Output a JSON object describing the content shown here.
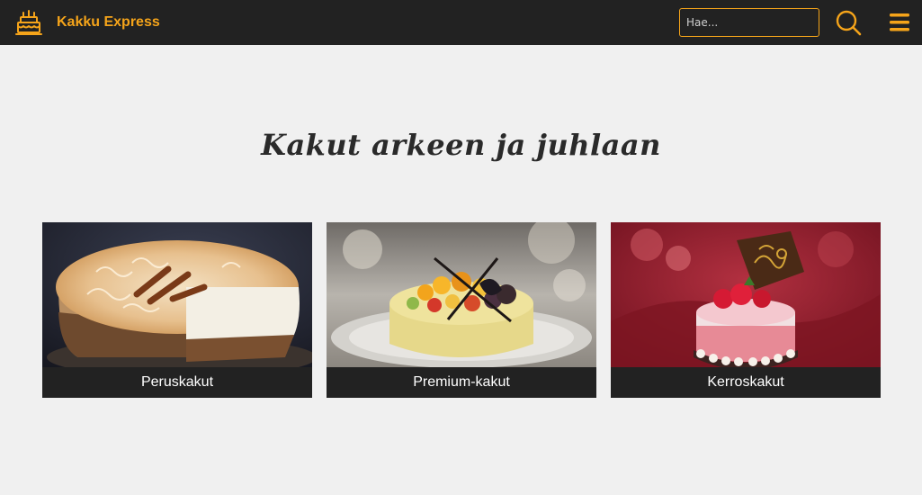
{
  "header": {
    "brand_name": "Kakku Express",
    "brand_icon": "cake-icon",
    "search_placeholder": "Hae...",
    "search_icon": "search-icon",
    "menu_icon": "hamburger-menu-icon",
    "accent_color": "#f5a41a",
    "bar_color": "#222222"
  },
  "main": {
    "title": "Kakut arkeen ja juhlaan",
    "background_color": "#f0f0f0",
    "categories": [
      {
        "label": "Peruskakut",
        "image": "cinnamon-cream-cake-photo"
      },
      {
        "label": "Premium-kakut",
        "image": "fruit-topped-cake-photo"
      },
      {
        "label": "Kerroskakut",
        "image": "strawberry-mousse-cake-photo"
      }
    ]
  }
}
